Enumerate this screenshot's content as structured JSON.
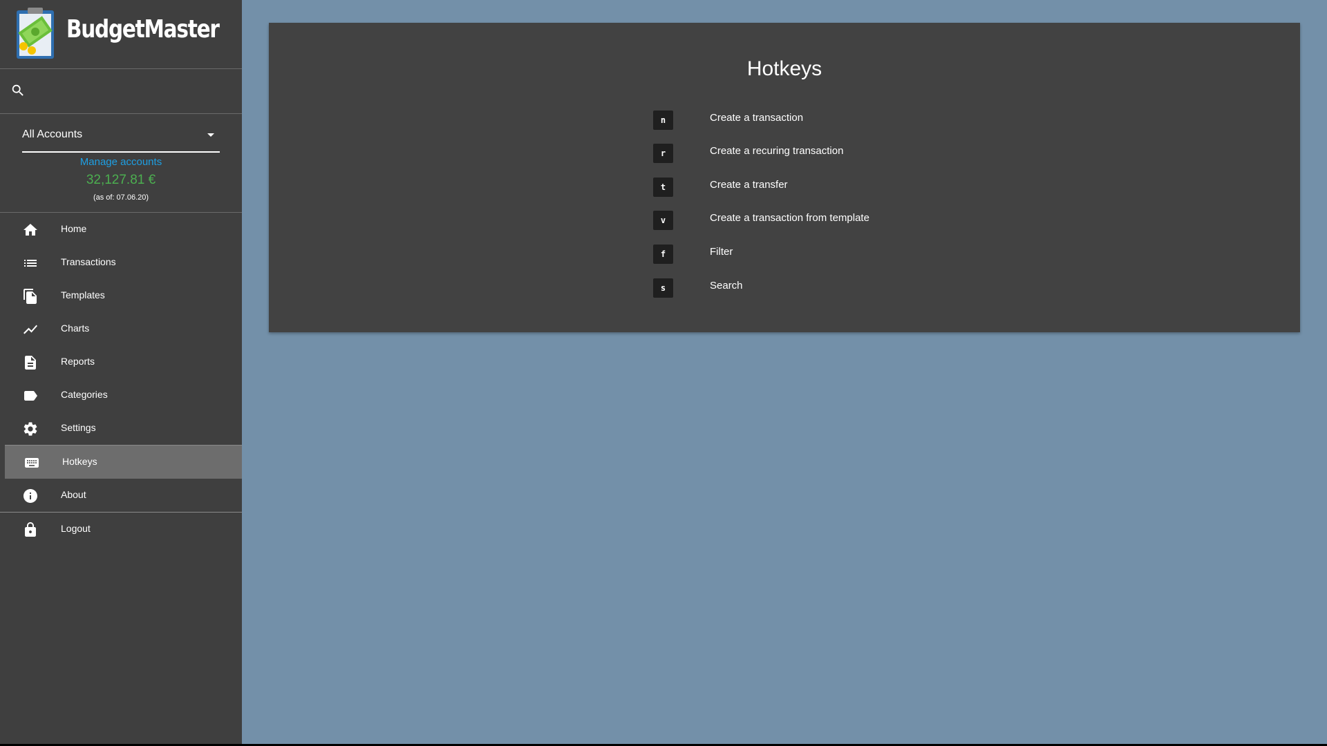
{
  "app": {
    "name": "BudgetMaster",
    "colors": {
      "sidebar_bg": "#3f3f3f",
      "page_bg": "#7390a9",
      "card_bg": "#424242",
      "link": "#1e9fe3",
      "balance": "#4caf50",
      "active_item_bg": "#6d6d6d"
    }
  },
  "search": {
    "placeholder": ""
  },
  "account": {
    "selected": "All Accounts",
    "manage_label": "Manage accounts",
    "balance": "32,127.81 €",
    "as_of": "(as of: 07.06.20)"
  },
  "nav": {
    "items": [
      {
        "label": "Home",
        "icon": "home-icon"
      },
      {
        "label": "Transactions",
        "icon": "list-icon"
      },
      {
        "label": "Templates",
        "icon": "copy-icon"
      },
      {
        "label": "Charts",
        "icon": "chart-line-icon"
      },
      {
        "label": "Reports",
        "icon": "document-icon"
      },
      {
        "label": "Categories",
        "icon": "label-icon"
      },
      {
        "label": "Settings",
        "icon": "gear-icon"
      },
      {
        "label": "Hotkeys",
        "icon": "keyboard-icon",
        "active": true
      },
      {
        "label": "About",
        "icon": "info-icon"
      },
      {
        "label": "Logout",
        "icon": "lock-icon"
      }
    ]
  },
  "hotkeys": {
    "title": "Hotkeys",
    "rows": [
      {
        "key": "n",
        "description": "Create a transaction"
      },
      {
        "key": "r",
        "description": "Create a recuring transaction"
      },
      {
        "key": "t",
        "description": "Create a transfer"
      },
      {
        "key": "v",
        "description": "Create a transaction from template"
      },
      {
        "key": "f",
        "description": "Filter"
      },
      {
        "key": "s",
        "description": "Search"
      }
    ]
  }
}
